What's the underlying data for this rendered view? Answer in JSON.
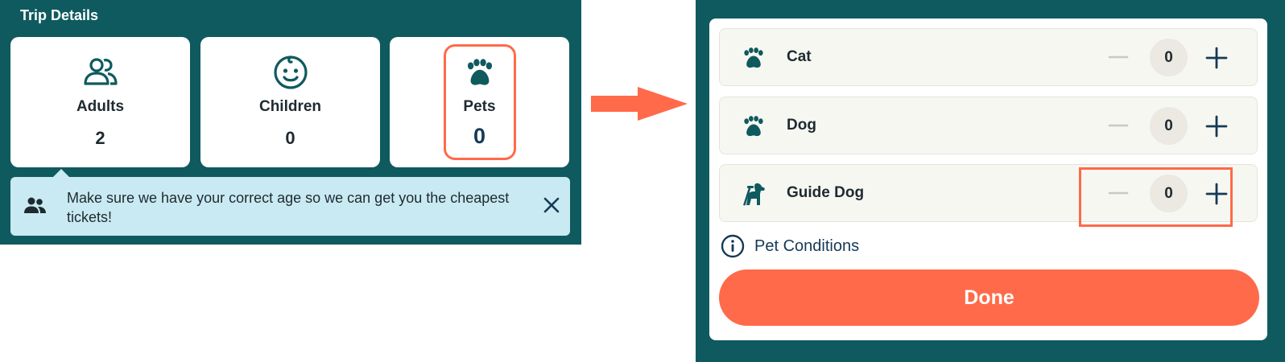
{
  "trip_details": {
    "title": "Trip Details",
    "cards": [
      {
        "label": "Adults",
        "value": "2",
        "icon": "adults-icon"
      },
      {
        "label": "Children",
        "value": "0",
        "icon": "child-face-icon"
      },
      {
        "label": "Pets",
        "value": "0",
        "icon": "paw-icon"
      }
    ],
    "banner": {
      "text": "Make sure we have your correct age so we can get you the cheapest tickets!",
      "icon": "people-icon",
      "close_icon": "close-icon"
    }
  },
  "pets_panel": {
    "rows": [
      {
        "label": "Cat",
        "count": "0",
        "icon": "paw-icon"
      },
      {
        "label": "Dog",
        "count": "0",
        "icon": "paw-icon"
      },
      {
        "label": "Guide Dog",
        "count": "0",
        "icon": "guide-dog-icon"
      }
    ],
    "conditions_link": "Pet Conditions",
    "done_label": "Done"
  },
  "colors": {
    "panel_bg": "#0f5a5e",
    "accent": "#ff6a4a",
    "banner_bg": "#c9eaf2",
    "row_bg": "#f7f7f2",
    "count_bg": "#ece8e2",
    "icon_teal": "#0f5a5e",
    "text_dark": "#1e2a30"
  }
}
